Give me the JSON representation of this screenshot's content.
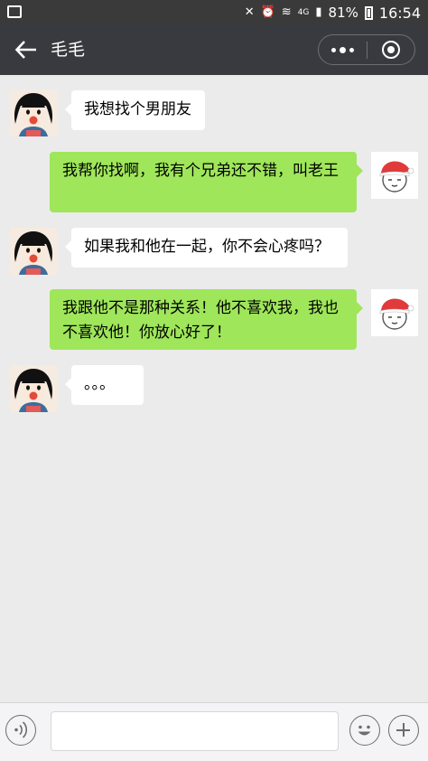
{
  "status_bar": {
    "battery_text": "81%",
    "time": "16:54",
    "network": "4G"
  },
  "header": {
    "title": "毛毛",
    "back_icon": "arrow-left-icon",
    "more_icon": "more-dots-icon",
    "close_icon": "target-circle-icon"
  },
  "messages": [
    {
      "sender": "other",
      "text": "我想找个男朋友"
    },
    {
      "sender": "me",
      "text": "我帮你找啊，我有个兄弟还不错，叫老王"
    },
    {
      "sender": "other",
      "text": "如果我和他在一起，你不会心疼吗？"
    },
    {
      "sender": "me",
      "text": "我跟他不是那种关系！他不喜欢我，我也不喜欢他！你放心好了！"
    },
    {
      "sender": "other",
      "text": "。。。"
    }
  ],
  "input_bar": {
    "placeholder": "",
    "voice_icon": "voice-icon",
    "emoji_icon": "emoji-icon",
    "plus_icon": "plus-icon"
  },
  "colors": {
    "title_bar": "#393a3f",
    "chat_bg": "#ebebeb",
    "outgoing_bubble": "#9fe65a",
    "incoming_bubble": "#ffffff"
  }
}
